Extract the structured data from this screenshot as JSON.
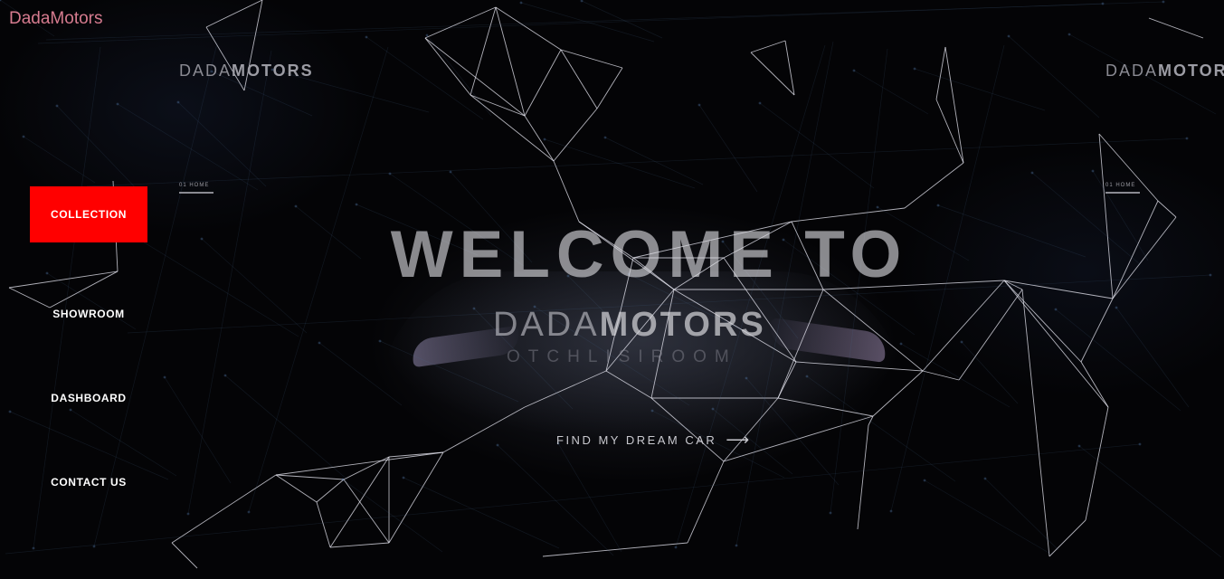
{
  "site_title": "DadaMotors",
  "brand": {
    "light": "DADA",
    "bold": "MOTORS"
  },
  "breadcrumb": "01   HOME",
  "nav": [
    {
      "label": "COLLECTION",
      "active": true
    },
    {
      "label": "SHOWROOM",
      "active": false
    },
    {
      "label": "DASHBOARD",
      "active": false
    },
    {
      "label": "CONTACT US",
      "active": false
    }
  ],
  "hero": {
    "headline": "WELCOME TO",
    "brand_light": "DADA",
    "brand_bold": "MOTORS",
    "tagline": "OTCHLISIROOM"
  },
  "cta": {
    "label": "FIND MY DREAM CAR",
    "icon": "arrow-right-icon"
  },
  "colors": {
    "accent": "#ff0000",
    "site_title": "#d67b8f",
    "background": "#040406"
  }
}
